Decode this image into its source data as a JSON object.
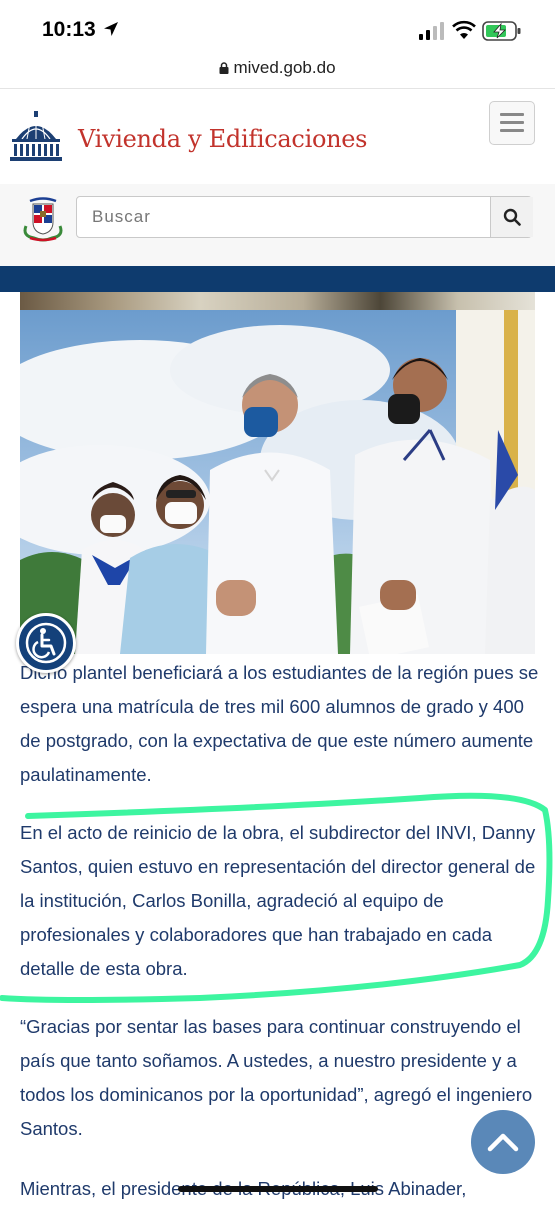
{
  "status_bar": {
    "time": "10:13",
    "icons": [
      "location-arrow-icon",
      "cellular-signal-icon",
      "wifi-icon",
      "battery-charging-icon"
    ]
  },
  "browser": {
    "url": "mived.gob.do",
    "icon": "lock-icon"
  },
  "header": {
    "site_name": "Vivienda y Edificaciones",
    "logo_icon": "capitol-dome-logo",
    "menu_icon": "hamburger-menu-icon"
  },
  "search": {
    "placeholder": "Buscar",
    "emblem_icon": "coat-of-arms-icon",
    "button_icon": "search-icon"
  },
  "article": {
    "paragraphs": [
      "Dicho plantel beneficiará a los estudiantes de la región pues se espera una matrícula de tres mil 600 alumnos de grado y 400 de postgrado, con la expectativa de que este número aumente paulatinamente.",
      "En el acto de reinicio de la obra, el subdirector del INVI, Danny Santos, quien estuvo en representación del director general de la institución, Carlos Bonilla, agradeció al equipo de profesionales y colaboradores que han trabajado en cada detalle de esta obra.",
      "“Gracias por sentar las bases para continuar construyendo el país que tanto soñamos. A ustedes, a nuestro presidente y a todos los dominicanos por la oportunidad”, agregó el ingeniero Santos.",
      "Mientras, el presidente de la República, Luis Abinader,"
    ]
  },
  "widgets": {
    "accessibility_icon": "wheelchair-accessibility-icon",
    "scroll_top_icon": "chevron-up-icon"
  },
  "colors": {
    "brand_red": "#c2332c",
    "navy": "#0e3b6e",
    "text_blue": "#1f3a6b",
    "highlight_green": "#3df5a0",
    "scroll_button": "#5a88b8"
  }
}
